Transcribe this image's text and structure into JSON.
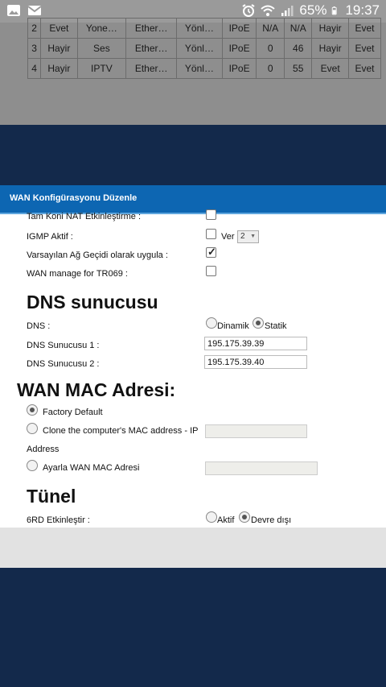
{
  "status": {
    "battery": "65%",
    "time": "19:37"
  },
  "bg_table": {
    "rows": [
      [
        "2",
        "Evet",
        "Yone…",
        "Ether…",
        "Yönl…",
        "IPoE",
        "N/A",
        "N/A",
        "Hayir",
        "Evet"
      ],
      [
        "3",
        "Hayir",
        "Ses",
        "Ether…",
        "Yönl…",
        "IPoE",
        "0",
        "46",
        "Hayir",
        "Evet"
      ],
      [
        "4",
        "Hayir",
        "IPTV",
        "Ether…",
        "Yönl…",
        "IPoE",
        "0",
        "55",
        "Evet",
        "Evet"
      ]
    ]
  },
  "dialog": {
    "title": "WAN Konfigürasyonu Düzenle",
    "full_cone_nat_label": "Tam Koni NAT Etkinleştirme :",
    "igmp_label": "IGMP Aktif :",
    "igmp_ver_label": "Ver",
    "igmp_ver_value": "2",
    "default_gw_label": "Varsayılan Ağ Geçidi olarak uygula :",
    "tr069_label": "WAN manage for TR069 :",
    "dns_heading": "DNS sunucusu",
    "dns_label": "DNS :",
    "dns_dynamic": "Dinamik",
    "dns_static": "Statik",
    "dns1_label": "DNS Sunucusu 1 :",
    "dns1_value": "195.175.39.39",
    "dns2_label": "DNS Sunucusu 2 :",
    "dns2_value": "195.175.39.40",
    "mac_heading": "WAN MAC Adresi:",
    "mac_factory": "Factory Default",
    "mac_clone": "Clone the computer's MAC address - IP",
    "mac_clone_cont": "Address",
    "mac_set": "Ayarla WAN MAC Adresi",
    "tunnel_heading": "Tünel",
    "rd6_label": "6RD Etkinleştir :",
    "rd6_active": "Aktif",
    "rd6_disabled": "Devre dışı"
  }
}
